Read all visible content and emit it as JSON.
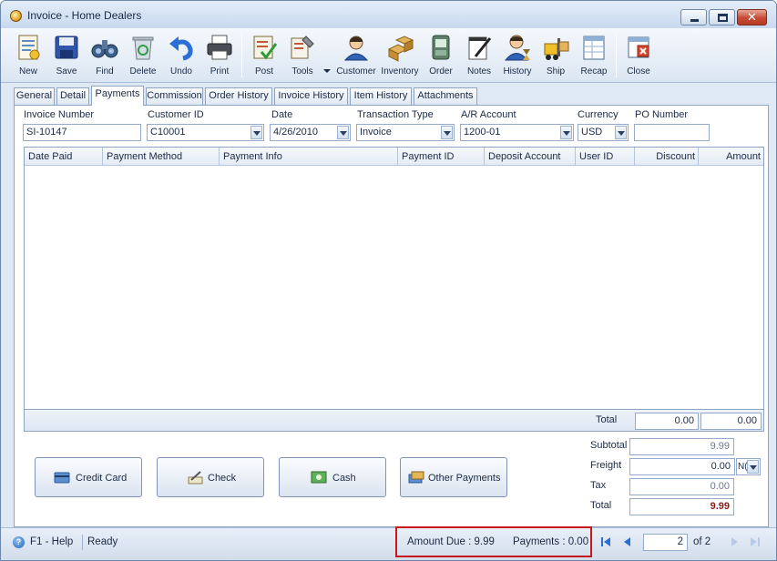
{
  "window": {
    "title": "Invoice - Home Dealers",
    "close_glyph": "✕"
  },
  "toolbar": {
    "items": [
      {
        "label": "New",
        "icon": "new-document-icon"
      },
      {
        "label": "Save",
        "icon": "save-disk-icon"
      },
      {
        "label": "Find",
        "icon": "binoculars-icon"
      },
      {
        "label": "Delete",
        "icon": "recycle-bin-icon"
      },
      {
        "label": "Undo",
        "icon": "undo-arrow-icon"
      },
      {
        "label": "Print",
        "icon": "printer-icon"
      },
      {
        "label": "Post",
        "icon": "post-checkmark-icon"
      },
      {
        "label": "Tools",
        "icon": "tools-icon"
      },
      {
        "label": "Customer",
        "icon": "customer-person-icon"
      },
      {
        "label": "Inventory",
        "icon": "inventory-boxes-icon"
      },
      {
        "label": "Order",
        "icon": "order-device-icon"
      },
      {
        "label": "Notes",
        "icon": "notes-pad-icon"
      },
      {
        "label": "History",
        "icon": "history-person-icon"
      },
      {
        "label": "Ship",
        "icon": "ship-forklift-icon"
      },
      {
        "label": "Recap",
        "icon": "recap-sheet-icon"
      },
      {
        "label": "Close",
        "icon": "close-window-icon"
      }
    ]
  },
  "tabs": [
    "General",
    "Detail",
    "Payments",
    "Commission",
    "Order History",
    "Invoice History",
    "Item History",
    "Attachments"
  ],
  "active_tab": "Payments",
  "form": {
    "invoice_number": {
      "label": "Invoice Number",
      "value": "SI-10147"
    },
    "customer_id": {
      "label": "Customer ID",
      "value": "C10001"
    },
    "date": {
      "label": "Date",
      "value": "4/26/2010"
    },
    "transaction_type": {
      "label": "Transaction Type",
      "value": "Invoice"
    },
    "ar_account": {
      "label": "A/R Account",
      "value": "1200-01"
    },
    "currency": {
      "label": "Currency",
      "value": "USD"
    },
    "po_number": {
      "label": "PO Number",
      "value": ""
    }
  },
  "grid": {
    "columns": [
      "Date Paid",
      "Payment Method",
      "Payment Info",
      "Payment ID",
      "Deposit Account",
      "User ID",
      "Discount",
      "Amount"
    ],
    "rows": [],
    "total_label": "Total",
    "total_discount": "0.00",
    "total_amount": "0.00"
  },
  "payment_buttons": {
    "credit_card": "Credit Card",
    "check": "Check",
    "cash": "Cash",
    "other": "Other Payments"
  },
  "summary": {
    "subtotal_label": "Subtotal",
    "subtotal": "9.99",
    "freight_label": "Freight",
    "freight": "0.00",
    "freight_code": "N(",
    "tax_label": "Tax",
    "tax": "0.00",
    "total_label": "Total",
    "total": "9.99",
    "total_color": "#8b1a1a"
  },
  "status": {
    "help": "F1 - Help",
    "ready": "Ready",
    "amount_due": "Amount Due : 9.99",
    "payments": "Payments : 0.00",
    "page": "2",
    "of": "of 2",
    "highlight_color": "#c8171a"
  }
}
